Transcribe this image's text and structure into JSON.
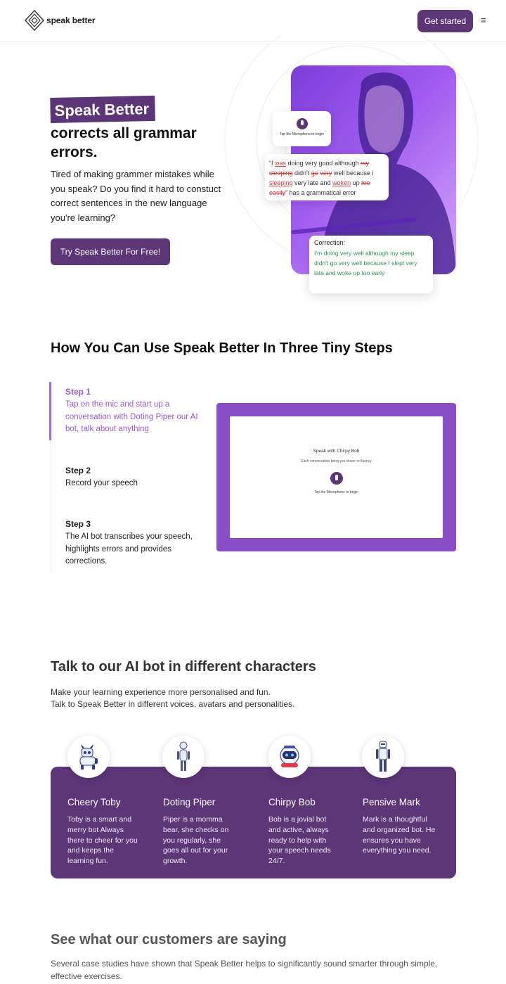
{
  "nav": {
    "logo_text": "speak better",
    "cta_label": "Get started",
    "menu_icon": "≡"
  },
  "hero": {
    "highlight": "Speak Better",
    "title": "corrects all grammar errors.",
    "description": "Tired of making grammer mistakes while you speak? Do you find it hard to constuct correct sentences in the new language you're learning?",
    "cta_label": "Try Speak Better For Free!",
    "mic_label": "Tap the Microphone to begin",
    "error_card": {
      "t1": "“I ",
      "t2": "was",
      "t3": " doing very good although ",
      "t4": "my",
      "t5": "sleeping",
      "t6": " didn't ",
      "t7": "go",
      "t8": " ",
      "t9": "very",
      "t10": " well because i ",
      "t11": "sleeping",
      "t12": " very late and ",
      "t13": "woken",
      "t14": " up ",
      "t15": "too easily",
      "t16": "” has a grammatical error"
    },
    "correction": {
      "title": "Correction:",
      "text": "I'm doing very well although my sleep didn't go very well because I slept very late and woke up too early"
    }
  },
  "steps": {
    "heading": "How You Can Use Speak Better In Three Tiny Steps",
    "items": [
      {
        "title": "Step 1",
        "desc": "Tap on the mic and start up a conversation with Doting Piper our AI bot, talk about anything"
      },
      {
        "title": "Step 2",
        "desc": "Record your speech"
      },
      {
        "title": "Step 3",
        "desc": "The AI bot transcribes your speech, highlights errors and provides corrections."
      }
    ],
    "demo": {
      "title": "Speak with Chirpy Bob",
      "subtitle": "Each conversation bring you closer to fluency",
      "tap": "Tap the Microphone to begin"
    }
  },
  "characters": {
    "heading": "Talk to our AI bot in different characters",
    "desc_line1": "Make your learning experience more personalised and fun.",
    "desc_line2": "Talk to Speak Better in different voices, avatars and personalities.",
    "items": [
      {
        "name": "Cheery Toby",
        "desc": "Toby is a smart and merry bot Always there to cheer for you and keeps the learning fun.",
        "icon": "robot-dog-icon"
      },
      {
        "name": "Doting Piper",
        "desc": "Piper is a momma bear, she checks on you regularly, she goes all out for your growth.",
        "icon": "humanoid-robot-icon"
      },
      {
        "name": "Chirpy Bob",
        "desc": "Bob is a jovial bot and active, always ready to help with your speech needs 24/7.",
        "icon": "astronaut-robot-icon"
      },
      {
        "name": "Pensive Mark",
        "desc": "Mark is a thoughtful and organized bot. He ensures you have everything you need.",
        "icon": "android-robot-icon"
      }
    ]
  },
  "customers": {
    "heading": "See what our customers are saying",
    "desc": "Several case studies have shown that Speak Better helps to significantly sound smarter through simple, effective exercises."
  },
  "colors": {
    "brand_purple": "#5c3677",
    "accent_purple": "#9c59cf",
    "error_red": "#d33c3c",
    "correction_green": "#2f8f5c"
  }
}
